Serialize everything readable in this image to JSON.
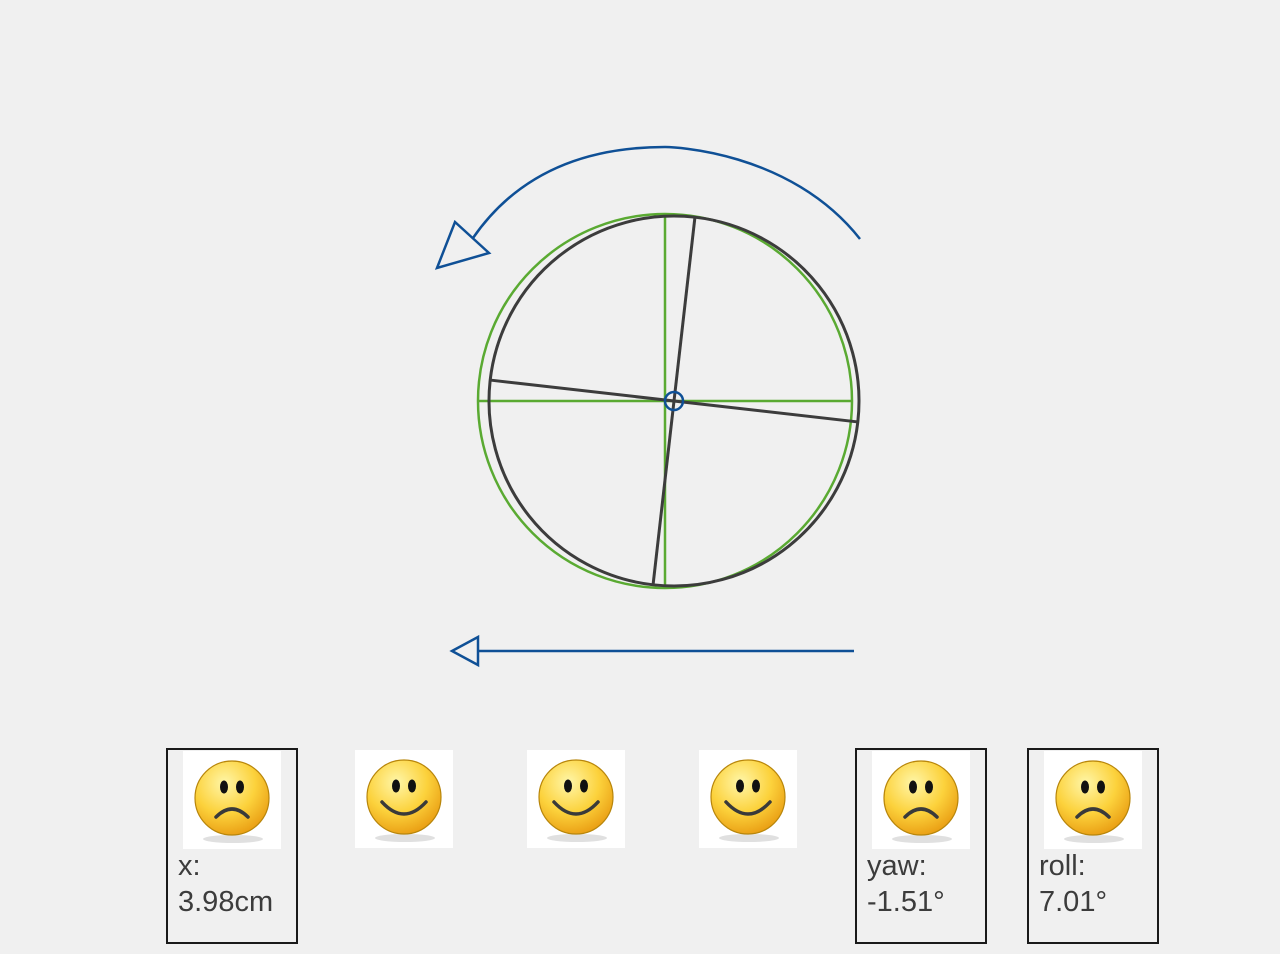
{
  "scene": {
    "wheel_tilt_deg": 6.5,
    "colors": {
      "reference_ring": "#5aaa32",
      "wheel": "#3c3c3c",
      "arrow": "#0f5096",
      "background": "#f0f0f0"
    },
    "rotation_arrow": {
      "direction": "counterclockwise"
    },
    "translation_arrow": {
      "direction": "left"
    }
  },
  "indicators": [
    {
      "id": "x",
      "state": "sad",
      "label": "x:",
      "value": "3.98cm"
    },
    {
      "id": "y",
      "state": "happy",
      "label": "",
      "value": ""
    },
    {
      "id": "z",
      "state": "happy",
      "label": "",
      "value": ""
    },
    {
      "id": "pitch",
      "state": "happy",
      "label": "",
      "value": ""
    },
    {
      "id": "yaw",
      "state": "sad",
      "label": "yaw:",
      "value": "-1.51°"
    },
    {
      "id": "roll",
      "state": "sad",
      "label": "roll:",
      "value": "7.01°"
    }
  ]
}
